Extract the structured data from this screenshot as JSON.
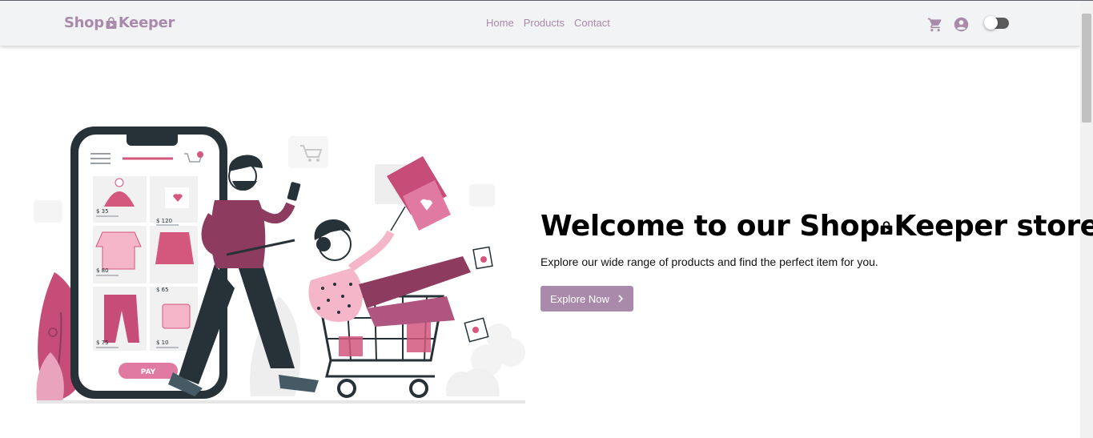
{
  "brand": {
    "part1": "Shop",
    "part2": "Keeper",
    "logo_icon": "shopping-bag-play-icon"
  },
  "nav": {
    "links": [
      "Home",
      "Products",
      "Contact"
    ]
  },
  "header_icons": {
    "cart": "cart-icon",
    "account": "account-circle-icon",
    "theme_toggle": "toggle-switch"
  },
  "hero": {
    "title_part1": "Welcome to our Shop",
    "title_part2": "Keeper store!",
    "subtitle": "Explore our wide range of products and find the perfect item for you.",
    "cta_label": "Explore Now",
    "cta_icon": "chevron-right-icon"
  },
  "illustration": {
    "prices": [
      "$ 35",
      "$ 120",
      "$ 80",
      "$ 65",
      "$ 75",
      "$ 10"
    ],
    "pay_label": "PAY"
  },
  "colors": {
    "accent": "#a98aaa",
    "pink": "#d4577e",
    "plum": "#8e3b60",
    "dark": "#263238"
  }
}
